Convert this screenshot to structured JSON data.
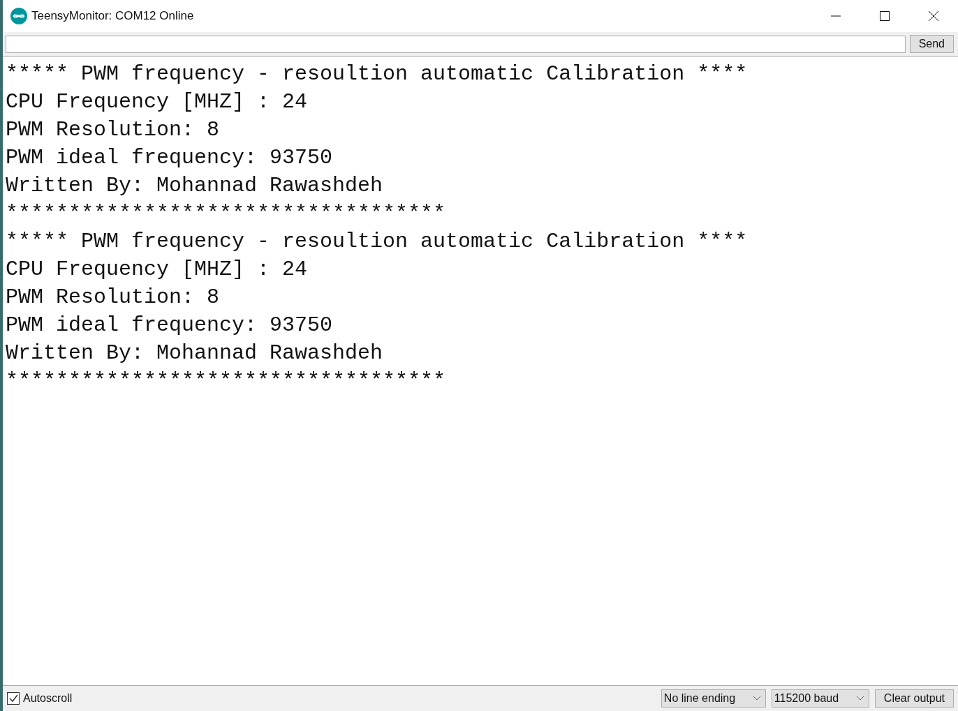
{
  "window": {
    "title": "TeensyMonitor: COM12 Online"
  },
  "input": {
    "button": "Send"
  },
  "output": [
    "***** PWM frequency - resoultion automatic Calibration ****",
    "CPU Frequency [MHZ] : 24",
    "PWM Resolution: 8",
    "PWM ideal frequency: 93750",
    "Written By: Mohannad Rawashdeh",
    "***********************************",
    "***** PWM frequency - resoultion automatic Calibration ****",
    "CPU Frequency [MHZ] : 24",
    "PWM Resolution: 8",
    "PWM ideal frequency: 93750",
    "Written By: Mohannad Rawashdeh",
    "***********************************"
  ],
  "footer": {
    "autoscroll": {
      "label": "Autoscroll",
      "checked": true
    },
    "line_ending": "No line ending",
    "baud": "115200 baud",
    "clear": "Clear output"
  }
}
